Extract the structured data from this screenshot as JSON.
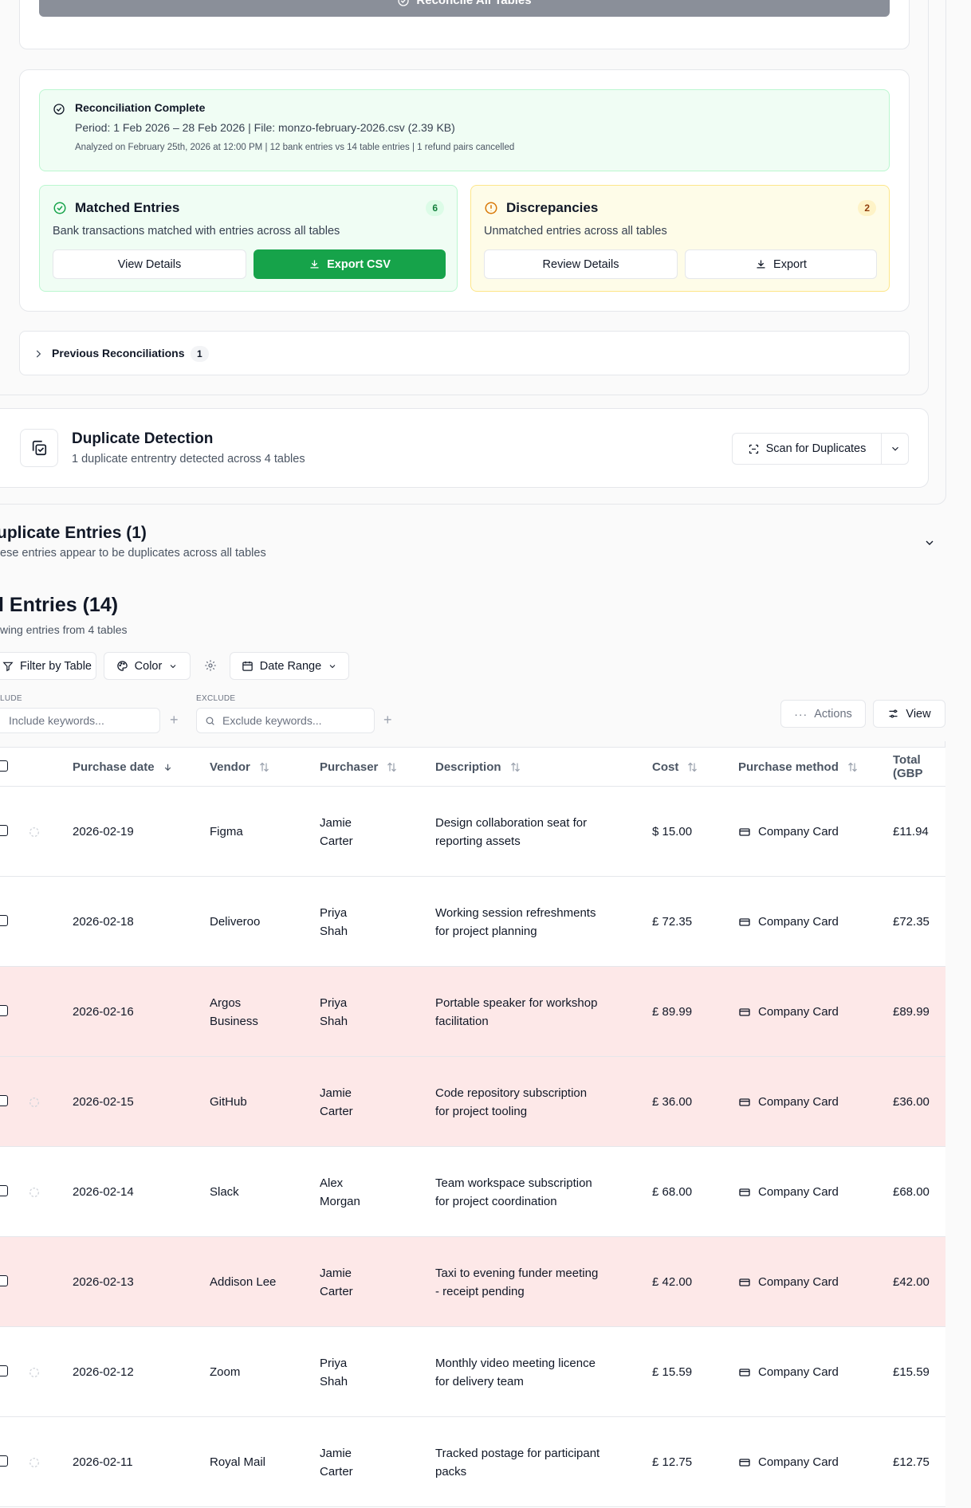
{
  "reconcile_all_label": "Reconcile All Tables",
  "recon": {
    "title": "Reconciliation Complete",
    "period_line": "Period: 1 Feb 2026 – 28 Feb 2026 | File: monzo-february-2026.csv (2.39 KB)",
    "analyzed_line": "Analyzed on February 25th, 2026 at 12:00 PM | 12 bank entries vs 14 table entries | 1 refund pairs cancelled"
  },
  "matched": {
    "title": "Matched Entries",
    "count": "6",
    "subtitle": "Bank transactions matched with entries across all tables",
    "view_label": "View Details",
    "export_label": "Export CSV"
  },
  "discrepancies": {
    "title": "Discrepancies",
    "count": "2",
    "subtitle": "Unmatched entries across all tables",
    "review_label": "Review Details",
    "export_label": "Export"
  },
  "previous": {
    "label": "Previous Reconciliations",
    "count": "1"
  },
  "duplicate_detection": {
    "title": "Duplicate Detection",
    "subtitle": "1 duplicate entrentry detected across 4 tables",
    "scan_label": "Scan for Duplicates"
  },
  "duplicate_entries": {
    "title": "uplicate Entries (1)",
    "subtitle": "ese entries appear to be duplicates across all tables"
  },
  "all_entries": {
    "title": "l Entries (14)",
    "subtitle": "wing entries from 4 tables"
  },
  "toolbar": {
    "filter_label": "Filter by Table",
    "color_label": "Color",
    "date_range_label": "Date Range",
    "include_label": "LUDE",
    "include_placeholder": "Include keywords...",
    "exclude_label": "EXCLUDE",
    "exclude_placeholder": "Exclude keywords...",
    "actions_label": "Actions",
    "view_label": "View"
  },
  "table": {
    "columns": {
      "date": "Purchase date",
      "vendor": "Vendor",
      "purchaser": "Purchaser",
      "description": "Description",
      "cost": "Cost",
      "method": "Purchase method",
      "total": "Total (GBP"
    },
    "rows": [
      {
        "date": "2026-02-19",
        "vendor": "Figma",
        "purchaser": "Jamie Carter",
        "description": "Design collaboration seat for reporting assets",
        "cost": "$ 15.00",
        "method": "Company Card",
        "total": "£11.94",
        "flagged": false,
        "spinner": true
      },
      {
        "date": "2026-02-18",
        "vendor": "Deliveroo",
        "purchaser": "Priya Shah",
        "description": "Working session refreshments for project planning",
        "cost": "£ 72.35",
        "method": "Company Card",
        "total": "£72.35",
        "flagged": false,
        "spinner": false
      },
      {
        "date": "2026-02-16",
        "vendor": "Argos Business",
        "purchaser": "Priya Shah",
        "description": "Portable speaker for workshop facilitation",
        "cost": "£ 89.99",
        "method": "Company Card",
        "total": "£89.99",
        "flagged": true,
        "spinner": false
      },
      {
        "date": "2026-02-15",
        "vendor": "GitHub",
        "purchaser": "Jamie Carter",
        "description": "Code repository subscription for project tooling",
        "cost": "£ 36.00",
        "method": "Company Card",
        "total": "£36.00",
        "flagged": true,
        "spinner": true
      },
      {
        "date": "2026-02-14",
        "vendor": "Slack",
        "purchaser": "Alex Morgan",
        "description": "Team workspace subscription for project coordination",
        "cost": "£ 68.00",
        "method": "Company Card",
        "total": "£68.00",
        "flagged": false,
        "spinner": true
      },
      {
        "date": "2026-02-13",
        "vendor": "Addison Lee",
        "purchaser": "Jamie Carter",
        "description": "Taxi to evening funder meeting - receipt pending",
        "cost": "£ 42.00",
        "method": "Company Card",
        "total": "£42.00",
        "flagged": true,
        "spinner": false
      },
      {
        "date": "2026-02-12",
        "vendor": "Zoom",
        "purchaser": "Priya Shah",
        "description": "Monthly video meeting licence for delivery team",
        "cost": "£ 15.59",
        "method": "Company Card",
        "total": "£15.59",
        "flagged": false,
        "spinner": true
      },
      {
        "date": "2026-02-11",
        "vendor": "Royal Mail",
        "purchaser": "Jamie Carter",
        "description": "Tracked postage for participant packs",
        "cost": "£ 12.75",
        "method": "Company Card",
        "total": "£12.75",
        "flagged": false,
        "spinner": true
      }
    ]
  },
  "colors": {
    "green": "#16a34a",
    "green_bg": "#f0fdf4",
    "yellow_bg": "#fefce8",
    "amber": "#d97706",
    "flagged_row": "#fde8e8"
  }
}
